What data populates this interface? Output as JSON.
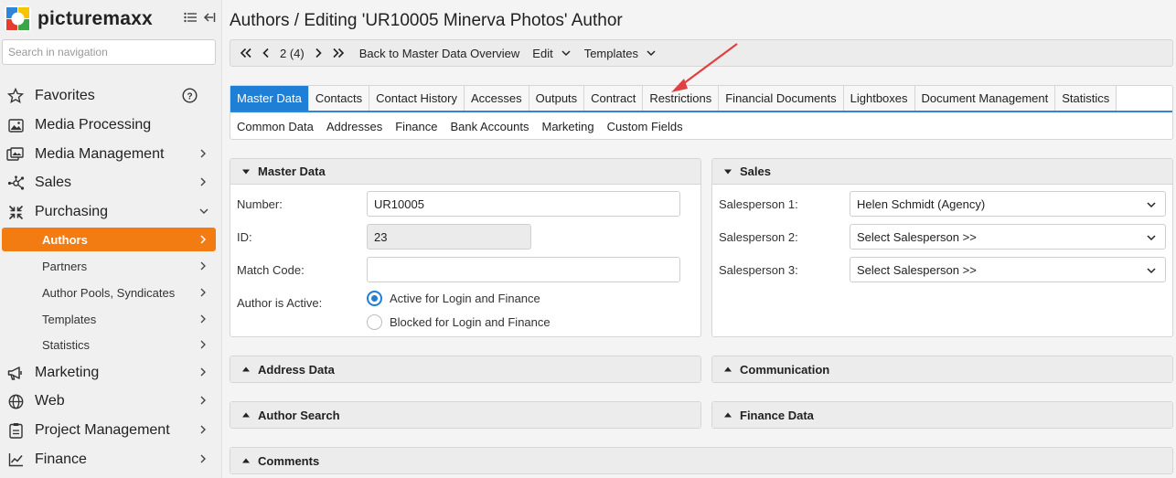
{
  "brand": {
    "name": "picturemaxx",
    "accent": "#f27b12"
  },
  "search": {
    "placeholder": "Search in navigation"
  },
  "nav": {
    "items": [
      {
        "label": "Favorites",
        "icon": "star-icon"
      },
      {
        "label": "Media Processing",
        "icon": "image-icon"
      },
      {
        "label": "Media Management",
        "icon": "media-management-icon"
      },
      {
        "label": "Sales",
        "icon": "network-icon"
      },
      {
        "label": "Purchasing",
        "icon": "purchasing-icon"
      },
      {
        "label": "Marketing",
        "icon": "megaphone-icon"
      },
      {
        "label": "Web",
        "icon": "globe-icon"
      },
      {
        "label": "Project Management",
        "icon": "clipboard-icon"
      },
      {
        "label": "Finance",
        "icon": "chart-icon"
      }
    ],
    "purchasing_sub": [
      {
        "label": "Authors",
        "active": true
      },
      {
        "label": "Partners"
      },
      {
        "label": "Author Pools, Syndicates"
      },
      {
        "label": "Templates"
      },
      {
        "label": "Statistics"
      }
    ]
  },
  "page": {
    "title": "Authors / Editing 'UR10005 Minerva Photos' Author"
  },
  "toolbar": {
    "position": "2 (4)",
    "back": "Back to Master Data Overview",
    "edit": "Edit",
    "templates": "Templates"
  },
  "tabs": [
    "Master Data",
    "Contacts",
    "Contact History",
    "Accesses",
    "Outputs",
    "Contract",
    "Restrictions",
    "Financial Documents",
    "Lightboxes",
    "Document Management",
    "Statistics"
  ],
  "subtabs": [
    "Common Data",
    "Addresses",
    "Finance",
    "Bank Accounts",
    "Marketing",
    "Custom Fields"
  ],
  "master_data": {
    "title": "Master Data",
    "number_label": "Number:",
    "number_value": "UR10005",
    "id_label": "ID:",
    "id_value": "23",
    "match_label": "Match Code:",
    "match_value": "",
    "active_label": "Author is Active:",
    "active_option": "Active for Login and Finance",
    "blocked_option": "Blocked for Login and Finance"
  },
  "sales": {
    "title": "Sales",
    "sp1_label": "Salesperson 1:",
    "sp1_value": "Helen Schmidt (Agency)",
    "sp2_label": "Salesperson 2:",
    "sp2_value": "Select Salesperson >>",
    "sp3_label": "Salesperson 3:",
    "sp3_value": "Select Salesperson >>"
  },
  "collapsed_panels": {
    "address": "Address Data",
    "communication": "Communication",
    "author_search": "Author Search",
    "finance": "Finance Data",
    "comments": "Comments"
  },
  "colors": {
    "tab_active": "#1f7fd6",
    "annotation_arrow": "#e04040"
  }
}
